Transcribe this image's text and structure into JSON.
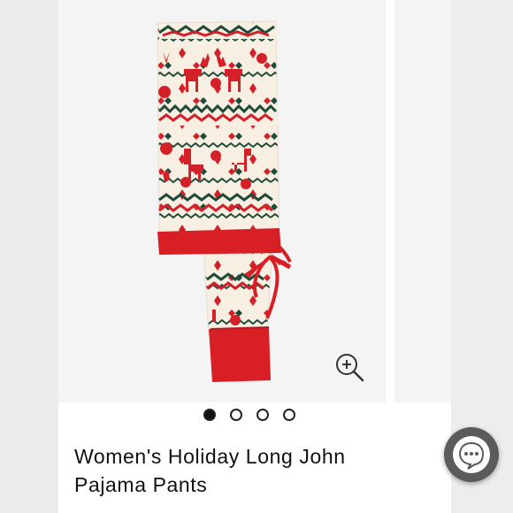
{
  "product": {
    "title": "Women's Holiday Long John Pajama Pants"
  },
  "gallery": {
    "image_count": 4,
    "active_index": 0
  },
  "icons": {
    "zoom": "zoom-in-icon",
    "chat": "chat-bubble-icon"
  },
  "colors": {
    "pattern_red": "#d42028",
    "pattern_green": "#1f4a3a",
    "fabric_cream": "#f6efe2",
    "cuff_red": "#d81f26",
    "chat_button": "#5b5b5b"
  }
}
